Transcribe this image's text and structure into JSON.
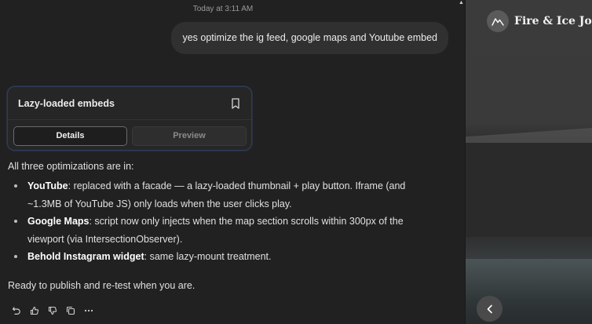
{
  "chat": {
    "timestamp": "Today at 3:11 AM",
    "user_message": "yes optimize the ig feed, google maps and Youtube embed",
    "artifact": {
      "title": "Lazy-loaded embeds",
      "tabs": [
        {
          "label": "Details",
          "active": true
        },
        {
          "label": "Preview",
          "active": false
        }
      ]
    },
    "response": {
      "intro": "All three optimizations are in:",
      "bullets": [
        {
          "title": "YouTube",
          "text": ": replaced with a facade — a lazy-loaded thumbnail + play button. Iframe (and ~1.3MB of YouTube JS) only loads when the user clicks play."
        },
        {
          "title": "Google Maps",
          "text": ": script now only injects when the map section scrolls within 300px of the viewport (via IntersectionObserver)."
        },
        {
          "title": "Behold Instagram widget",
          "text": ": same lazy-mount treatment."
        }
      ],
      "outro": "Ready to publish and re-test when you are."
    },
    "actions": [
      "retry-icon",
      "thumbs-up-icon",
      "thumbs-down-icon",
      "copy-icon",
      "more-icon"
    ]
  },
  "preview": {
    "site_title": "Fire & Ice Jou",
    "logo_icon": "mountain-icon",
    "nav_icon": "chevron-left-icon"
  }
}
